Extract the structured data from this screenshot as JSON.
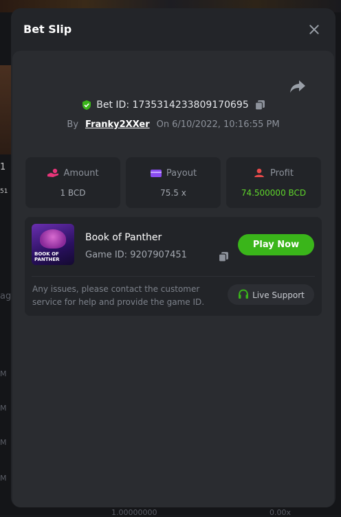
{
  "modal": {
    "title": "Bet Slip"
  },
  "bet": {
    "id_label": "Bet ID: 1735314233809170695",
    "by_label": "By",
    "user": "Franky2XXer",
    "on_label": "On",
    "timestamp": "6/10/2022, 10:16:55 PM"
  },
  "stats": {
    "amount_label": "Amount",
    "amount_value": "1 BCD",
    "payout_label": "Payout",
    "payout_value": "75.5 x",
    "profit_label": "Profit",
    "profit_value": "74.500000 BCD"
  },
  "game": {
    "name": "Book of Panther",
    "id_label": "Game ID: 9207907451",
    "thumb_title": "BOOK OF PANTHER",
    "play_label": "Play Now"
  },
  "support": {
    "note": "Any issues, please contact the customer service for help and provide the game ID.",
    "button_label": "Live Support"
  },
  "background": {
    "left_glyph": "1",
    "left_small": "51",
    "left_side": "ag",
    "left_m": "M",
    "bottom_amount": "1.00000000",
    "bottom_right": "0.00x"
  },
  "colors": {
    "accent_green": "#3ab51a",
    "profit_green": "#5fd62b",
    "amount_icon": "#e8357a",
    "payout_icon": "#8a4cf0",
    "profit_icon": "#e84a4a",
    "shield": "#3ab51a"
  },
  "icons": {
    "close": "close-icon",
    "share": "share-icon",
    "verified": "shield-check-icon",
    "copy": "copy-icon",
    "amount": "hand-coin-icon",
    "payout": "wallet-icon",
    "profit": "user-profit-icon",
    "support": "headset-icon"
  }
}
